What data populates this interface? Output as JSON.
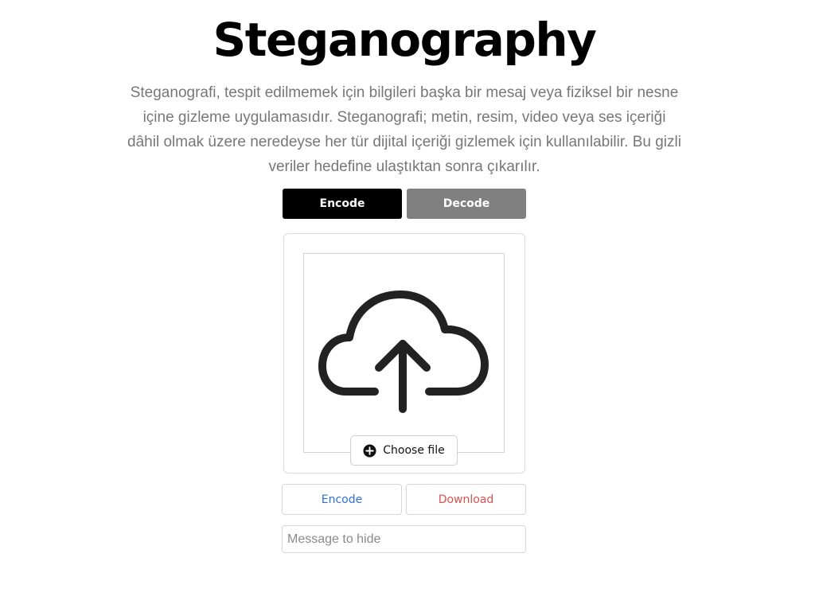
{
  "header": {
    "title": "Steganography",
    "description": "Steganografi, tespit edilmemek için bilgileri başka bir mesaj veya fiziksel bir nesne içine gizleme uygulamasıdır. Steganografi; metin, resim, video veya ses içeriği dâhil olmak üzere neredeyse her tür dijital içeriği gizlemek için kullanılabilir. Bu gizli veriler hedefine ulaştıktan sonra çıkarılır."
  },
  "mode_tabs": [
    {
      "label": "Encode",
      "state": "active",
      "color": "#000000"
    },
    {
      "label": "Decode",
      "state": "inactive",
      "color": "#808080"
    }
  ],
  "upload": {
    "icon": "cloud-upload-icon",
    "choose_file_label": "Choose file",
    "choose_file_icon": "plus-circle-icon"
  },
  "actions": {
    "encode_label": "Encode",
    "encode_color": "#2f6fd1",
    "download_label": "Download",
    "download_color": "#d9534f"
  },
  "message": {
    "placeholder": "Message to hide",
    "value": ""
  }
}
